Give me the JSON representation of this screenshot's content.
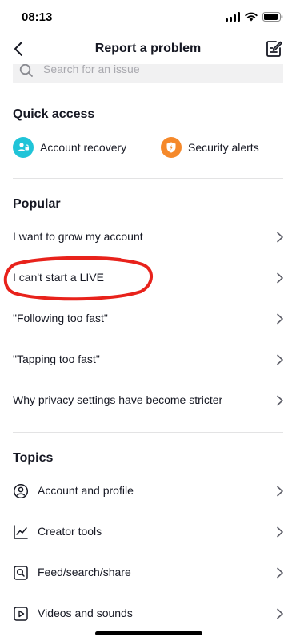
{
  "status_bar": {
    "time": "08:13"
  },
  "header": {
    "title": "Report a problem"
  },
  "search": {
    "placeholder": "Search for an issue"
  },
  "quick_access": {
    "title": "Quick access",
    "items": [
      {
        "label": "Account recovery",
        "icon": "account-recovery-icon",
        "color": "#20c4d8"
      },
      {
        "label": "Security alerts",
        "icon": "security-shield-icon",
        "color": "#f5892b"
      }
    ]
  },
  "popular": {
    "title": "Popular",
    "items": [
      {
        "label": "I want to grow my account"
      },
      {
        "label": "I can't start a LIVE"
      },
      {
        "label": "\"Following too fast\""
      },
      {
        "label": "\"Tapping too fast\""
      },
      {
        "label": "Why privacy settings have become stricter"
      }
    ]
  },
  "topics": {
    "title": "Topics",
    "items": [
      {
        "label": "Account and profile",
        "icon": "profile-icon"
      },
      {
        "label": "Creator tools",
        "icon": "chart-line-icon"
      },
      {
        "label": "Feed/search/share",
        "icon": "search-box-icon"
      },
      {
        "label": "Videos and sounds",
        "icon": "video-icon"
      }
    ]
  },
  "colors": {
    "highlight": "#e8221b",
    "text": "#161823"
  }
}
